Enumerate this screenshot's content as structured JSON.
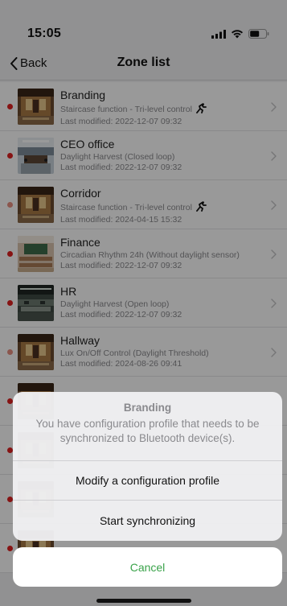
{
  "status_bar": {
    "time": "15:05",
    "icons": [
      "signal-icon",
      "wifi-icon",
      "battery-icon"
    ]
  },
  "nav": {
    "back_label": "Back",
    "title": "Zone list"
  },
  "colors": {
    "dot_red": "#e02020",
    "dot_salmon": "#e89080",
    "accent_green": "#3aa34a"
  },
  "zones": [
    {
      "name": "Branding",
      "function": "Staircase function - Tri-level control",
      "modified": "Last modified: 2022-12-07 09:32",
      "dot": "red",
      "sensor_icon": true,
      "thumb": "lobby"
    },
    {
      "name": "CEO office",
      "function": "Daylight Harvest (Closed loop)",
      "modified": "Last modified: 2022-12-07 09:32",
      "dot": "red",
      "sensor_icon": false,
      "thumb": "meeting"
    },
    {
      "name": "Corridor",
      "function": "Staircase function - Tri-level control",
      "modified": "Last modified: 2024-04-15 15:32",
      "dot": "salmon",
      "sensor_icon": true,
      "thumb": "lobby"
    },
    {
      "name": "Finance",
      "function": "Circadian Rhythm 24h (Without daylight sensor)",
      "modified": "Last modified: 2022-12-07 09:32",
      "dot": "red",
      "sensor_icon": false,
      "thumb": "classroom"
    },
    {
      "name": "HR",
      "function": "Daylight Harvest (Open loop)",
      "modified": "Last modified: 2022-12-07 09:32",
      "dot": "red",
      "sensor_icon": false,
      "thumb": "office"
    },
    {
      "name": "Hallway",
      "function": "Lux On/Off Control (Daylight Threshold)",
      "modified": "Last modified: 2024-08-26 09:41",
      "dot": "salmon",
      "sensor_icon": false,
      "thumb": "lobby"
    }
  ],
  "sheet": {
    "title": "Branding",
    "message": "You have configuration profile that needs to be synchronized to Bluetooth device(s).",
    "actions": [
      "Modify a configuration profile",
      "Start synchronizing"
    ],
    "cancel": "Cancel"
  }
}
